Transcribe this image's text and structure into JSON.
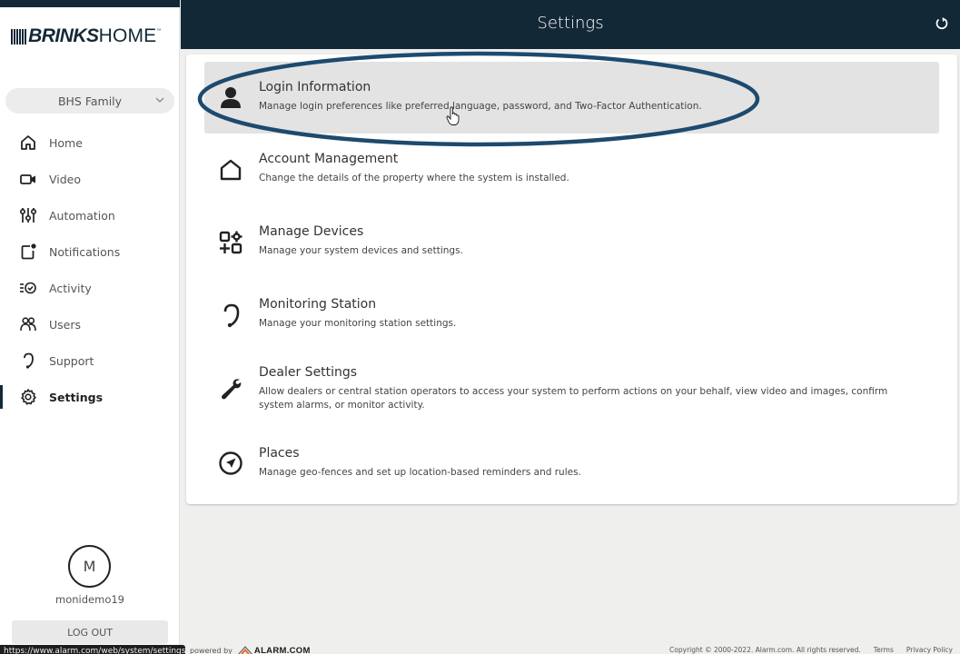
{
  "brand": {
    "name_bold": "BRINKS",
    "name_light": "HOME",
    "trademark": "™"
  },
  "system_selector": {
    "value": "BHS Family",
    "icon": "chevron-down-icon"
  },
  "sidebar": {
    "items": [
      {
        "label": "Home",
        "icon": "home-icon",
        "active": false
      },
      {
        "label": "Video",
        "icon": "video-camera-icon",
        "active": false
      },
      {
        "label": "Automation",
        "icon": "sliders-icon",
        "active": false
      },
      {
        "label": "Notifications",
        "icon": "notification-icon",
        "active": false
      },
      {
        "label": "Activity",
        "icon": "activity-icon",
        "active": false
      },
      {
        "label": "Users",
        "icon": "users-icon",
        "active": false
      },
      {
        "label": "Support",
        "icon": "headset-icon",
        "active": false
      },
      {
        "label": "Settings",
        "icon": "gear-icon",
        "active": true
      }
    ]
  },
  "user": {
    "initial": "M",
    "username": "monidemo19",
    "logout_label": "LOG OUT"
  },
  "header": {
    "title": "Settings",
    "refresh_icon": "refresh-icon"
  },
  "settings": [
    {
      "title": "Login Information",
      "description": "Manage login preferences like preferred language, password, and Two-Factor Authentication.",
      "icon": "user-icon",
      "highlighted": true
    },
    {
      "title": "Account Management",
      "description": "Change the details of the property where the system is installed.",
      "icon": "house-outline-icon",
      "highlighted": false
    },
    {
      "title": "Manage Devices",
      "description": "Manage your system devices and settings.",
      "icon": "devices-icon",
      "highlighted": false
    },
    {
      "title": "Monitoring Station",
      "description": "Manage your monitoring station settings.",
      "icon": "headset-icon",
      "highlighted": false
    },
    {
      "title": "Dealer Settings",
      "description": "Allow dealers or central station operators to access your system to perform actions on your behalf, view video and images, confirm system alarms, or monitor activity.",
      "icon": "wrench-icon",
      "highlighted": false
    },
    {
      "title": "Places",
      "description": "Manage geo-fences and set up location-based reminders and rules.",
      "icon": "navigation-icon",
      "highlighted": false
    }
  ],
  "footer": {
    "status_url": "https://www.alarm.com/web/system/settings",
    "powered_by": "powered by",
    "alarm_brand": "ALARM.COM",
    "copyright": "Copyright © 2000-2022. Alarm.com. All rights reserved.",
    "terms": "Terms",
    "privacy": "Privacy Policy"
  },
  "colors": {
    "header_bg": "#132837",
    "annotation": "#1d4a6e",
    "hover_row": "#e3e3e3",
    "page_bg": "#efefee"
  }
}
